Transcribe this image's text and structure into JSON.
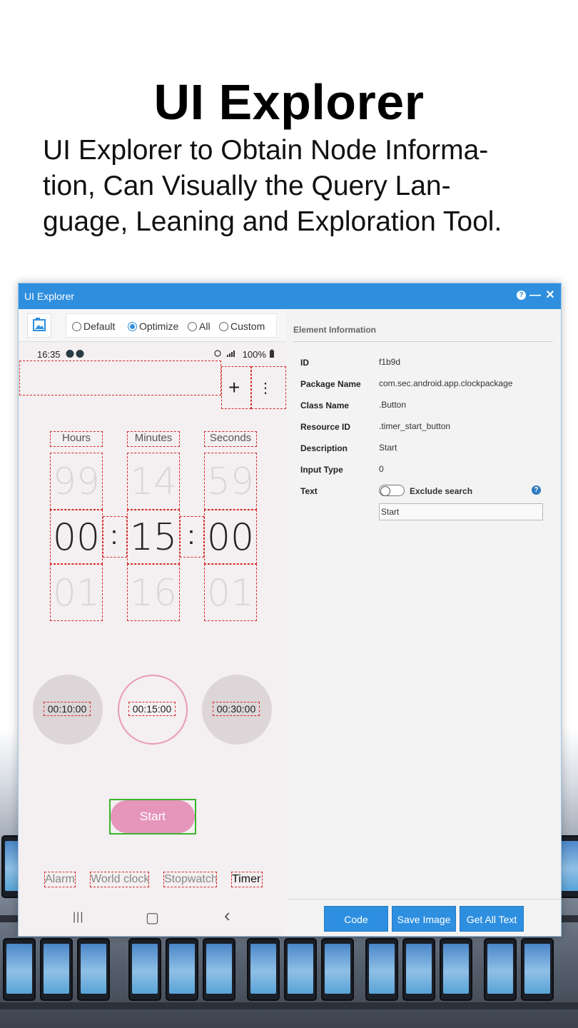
{
  "hero": {
    "title": "UI Explorer",
    "subtitle_lines": [
      "UI Explorer to Obtain Node Informa-",
      "tion, Can Visually the Query Lan-",
      "guage, Leaning and Exploration Tool."
    ]
  },
  "window": {
    "title": "UI Explorer",
    "help_glyph": "?",
    "minimize_glyph": "—",
    "close_glyph": "✕"
  },
  "toolbar": {
    "screenshot_icon": "screenshot-icon",
    "modes": [
      {
        "label": "Default",
        "selected": false
      },
      {
        "label": "Optimize",
        "selected": true
      },
      {
        "label": "All",
        "selected": false
      },
      {
        "label": "Custom",
        "selected": false
      }
    ]
  },
  "phone": {
    "status": {
      "time": "16:35",
      "right": "100%"
    },
    "toolbar_glyphs": {
      "add": "+",
      "more": "⋮"
    },
    "picker": {
      "labels": [
        "Hours",
        "Minutes",
        "Seconds"
      ],
      "above": [
        "99",
        "14",
        "59"
      ],
      "current": [
        "00",
        "15",
        "00"
      ],
      "below": [
        "01",
        "16",
        "01"
      ],
      "separator": ":"
    },
    "presets": [
      "00:10:00",
      "00:15:00",
      "00:30:00"
    ],
    "selected_preset": 1,
    "start_label": "Start",
    "tabs": [
      {
        "label": "Alarm",
        "active": false
      },
      {
        "label": "World clock",
        "active": false
      },
      {
        "label": "Stopwatch",
        "active": false
      },
      {
        "label": "Timer",
        "active": true
      }
    ],
    "nav": {
      "recent": "|||",
      "home": "▢",
      "back": "‹"
    }
  },
  "element_info": {
    "heading": "Element Information",
    "fields": [
      {
        "key": "ID",
        "value": "f1b9d"
      },
      {
        "key": "Package Name",
        "value": "com.sec.android.app.clockpackage"
      },
      {
        "key": "Class Name",
        "value": ".Button"
      },
      {
        "key": "Resource ID",
        "value": ".timer_start_button"
      },
      {
        "key": "Description",
        "value": "Start"
      },
      {
        "key": "Input Type",
        "value": "0"
      }
    ],
    "text_key": "Text",
    "exclude_label": "Exclude search",
    "exclude_on": false,
    "text_value": "Start",
    "help_glyph": "?"
  },
  "actions": {
    "code": "Code",
    "save_image": "Save Image",
    "get_all_text": "Get All Text"
  },
  "colors": {
    "accent": "#2f8fde",
    "start_pink": "#e695bb",
    "selection_green": "#38b62e",
    "dashed_red": "#d42a2a"
  }
}
